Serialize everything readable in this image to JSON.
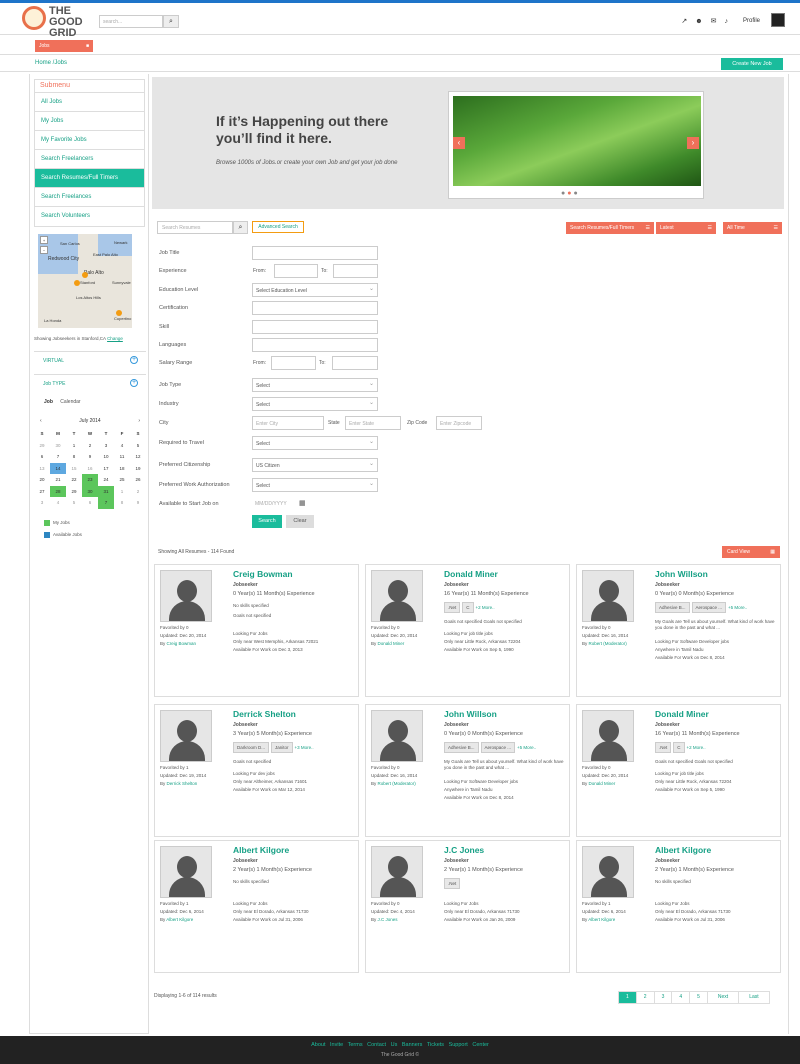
{
  "header": {
    "logo_text": "THE GOOD GRID",
    "search_placeholder": "search...",
    "profile_label": "Profile"
  },
  "jobs_tab": {
    "label": "Jobs"
  },
  "breadcrumb": "Home /Jobs",
  "create_button": "Create New Job",
  "sidebar": {
    "title": "Submenu",
    "items": [
      {
        "label": "All Jobs"
      },
      {
        "label": "My Jobs"
      },
      {
        "label": "My Favorite Jobs"
      },
      {
        "label": "Search Freelancers"
      },
      {
        "label": "Search Resumes/Full Timers"
      },
      {
        "label": "Search Freelances"
      },
      {
        "label": "Search Volunteers"
      }
    ],
    "map_labels": [
      "Redwood City",
      "Palo Alto",
      "Stanford",
      "Sunnyvale",
      "Los Altos Hills",
      "Cupertino",
      "La Honda",
      "Newark",
      "San Carlos",
      "East Palo Alto"
    ],
    "showing_text": "Showing Jobseekers in Stanford,CA",
    "change_link": "Change",
    "virtual_label": "VIRTUAL",
    "job_type_label": "Job TYPE",
    "tab_job": "Job",
    "tab_calendar": "Calendar",
    "calendar_month": "July 2014",
    "calendar_dow": [
      "S",
      "M",
      "T",
      "W",
      "T",
      "F",
      "S"
    ],
    "legend_my": "My Jobs",
    "legend_available": "Available Jobs"
  },
  "banner": {
    "headline": "If it’s Happening out there you’ll find it here.",
    "sub": "Browse 1000s of Jobs.or create your own Job and get your job done"
  },
  "toolbar": {
    "search_placeholder": "Search Resumes",
    "advanced": "Advanced Search",
    "filter_resumes": "Search Resumes/Full Timers",
    "filter_latest": "Latest",
    "filter_time": "All Time"
  },
  "form": {
    "job_title": "Job Title",
    "experience": "Experience",
    "from": "From:",
    "to": "To:",
    "education": "Education Level",
    "education_value": "Select Education Level",
    "certification": "Certification",
    "skill": "Skill",
    "languages": "Languages",
    "salary": "Salary Range",
    "job_type": "Job Type",
    "industry": "Industry",
    "select": "Select",
    "city": "City",
    "city_ph": "Enter City",
    "state": "State",
    "state_ph": "Enter State",
    "zip": "Zip Code",
    "zip_ph": "Enter Zipcode",
    "travel": "Required to Travel",
    "citizenship": "Preferred Citizenship",
    "citizenship_value": "US Citizen",
    "work_auth": "Preferred Work Authorization",
    "start": "Available to Start Job on",
    "date_ph": "MM/DD/YYYY",
    "search_btn": "Search",
    "clear_btn": "Clear"
  },
  "results": {
    "showing": "Showing All Resumes - 114 Found",
    "card_view": "Card View",
    "displaying": "Displaying 1-6 of 114 results",
    "pages": [
      "1",
      "2",
      "3",
      "4",
      "5",
      "Next",
      "Last"
    ]
  },
  "cards": [
    {
      "name": "Creig Bowman",
      "role": "Jobseeker",
      "exp": "0 Year(s) 11 Month(s) Experience",
      "skills_text": "No skills specified",
      "goals": "Goals not specified",
      "fav": "Favorited by 0",
      "updated": "Updated: Dec 20, 2014",
      "by": "Creig Bowman",
      "l1": "Looking For Jobs",
      "l2": "Only near West Memphis, Arkansas 72021",
      "l3": "Available For Work on Dec 3, 2013"
    },
    {
      "name": "Donald Miner",
      "role": "Jobseeker",
      "exp": "16 Year(s) 11 Month(s) Experience",
      "chips": [
        ".Net",
        "C"
      ],
      "more": "+2 More..",
      "goals": "Goals not specified Goals not specified",
      "fav": "Favorited by 0",
      "updated": "Updated: Dec 20, 2014",
      "by": "Donald Miner",
      "l1": "Looking For job title jobs",
      "l2": "Only near Little Rock, Arkansas 72204",
      "l3": "Available For Work on Sep 5, 1990"
    },
    {
      "name": "John Willson",
      "role": "Jobseeker",
      "exp": "0 Year(s) 0 Month(s) Experience",
      "chips": [
        "Adhesive B...",
        "Aerospace ..."
      ],
      "more": "+5 More..",
      "goals": "My Goals are Tell us about yourself. What kind of work have you done in the past and what ...",
      "fav": "Favorited by 0",
      "updated": "Updated: Dec 16, 2014",
      "by": "Robert (Moderator)",
      "l1": "Looking For Software Developer jobs",
      "l2": "Anywhere in Tamil Nadu",
      "l3": "Available For Work on Dec 8, 2014"
    },
    {
      "name": "Derrick Shelton",
      "role": "Jobseeker",
      "exp": "3 Year(s) 5 Month(s) Experience",
      "chips": [
        "Darkroom D...",
        "Janitor"
      ],
      "more": "+3 More..",
      "goals": "Goals not specified",
      "fav": "Favorited by 1",
      "updated": "Updated: Dec 19, 2014",
      "by": "Derrick Shelton",
      "l1": "Looking For dev jobs",
      "l2": "Only near Altheimer, Arkansas 71601",
      "l3": "Available For Work on Mar 12, 2014"
    },
    {
      "name": "John Willson",
      "role": "Jobseeker",
      "exp": "0 Year(s) 0 Month(s) Experience",
      "chips": [
        "Adhesive B...",
        "Aerospace ..."
      ],
      "more": "+5 More..",
      "goals": "My Goals are Tell us about yourself. What kind of work have you done in the past and what ...",
      "fav": "Favorited by 0",
      "updated": "Updated: Dec 16, 2014",
      "by": "Robert (Moderator)",
      "l1": "Looking For Software Developer jobs",
      "l2": "Anywhere in Tamil Nadu",
      "l3": "Available For Work on Dec 8, 2014"
    },
    {
      "name": "Donald Miner",
      "role": "Jobseeker",
      "exp": "16 Year(s) 11 Month(s) Experience",
      "chips": [
        ".Net",
        "C"
      ],
      "more": "+2 More..",
      "goals": "Goals not specified Goals not specified",
      "fav": "Favorited by 0",
      "updated": "Updated: Dec 20, 2014",
      "by": "Donald Miner",
      "l1": "Looking For job title jobs",
      "l2": "Only near Little Rock, Arkansas 72204",
      "l3": "Available For Work on Sep 5, 1990"
    },
    {
      "name": "Albert Kilgore",
      "role": "Jobseeker",
      "exp": "2 Year(s) 1 Month(s) Experience",
      "skills_text": "No skills specified",
      "goals": "",
      "fav": "Favorited by 1",
      "updated": "Updated: Dec 6, 2014",
      "by": "Albert Kilgore",
      "l1": "Looking For Jobs",
      "l2": "Only near El Dorado, Arkansas 71730",
      "l3": "Available For Work on Jul 31, 2006"
    },
    {
      "name": "J.C Jones",
      "role": "Jobseeker",
      "exp": "2 Year(s) 1 Month(s) Experience",
      "chips": [
        ".Net"
      ],
      "more": "",
      "goals": "",
      "fav": "Favorited by 0",
      "updated": "Updated: Dec 4, 2014",
      "by": "J.C Jones",
      "l1": "Looking For Jobs",
      "l2": "Only near El Dorado, Arkansas 71730",
      "l3": "Available For Work on Jan 26, 2009"
    },
    {
      "name": "Albert Kilgore",
      "role": "Jobseeker",
      "exp": "2 Year(s) 1 Month(s) Experience",
      "skills_text": "No skills specified",
      "goals": "",
      "fav": "Favorited by 1",
      "updated": "Updated: Dec 6, 2014",
      "by": "Albert Kilgore",
      "l1": "Looking For Jobs",
      "l2": "Only near El Dorado, Arkansas 71730",
      "l3": "Available For Work on Jul 31, 2006"
    }
  ],
  "footer": {
    "links": [
      "About",
      "Invite",
      "Terms",
      "Contact Us",
      "Banners",
      "Tickets",
      "Support Center"
    ],
    "copy": "The Good Grid ©"
  }
}
